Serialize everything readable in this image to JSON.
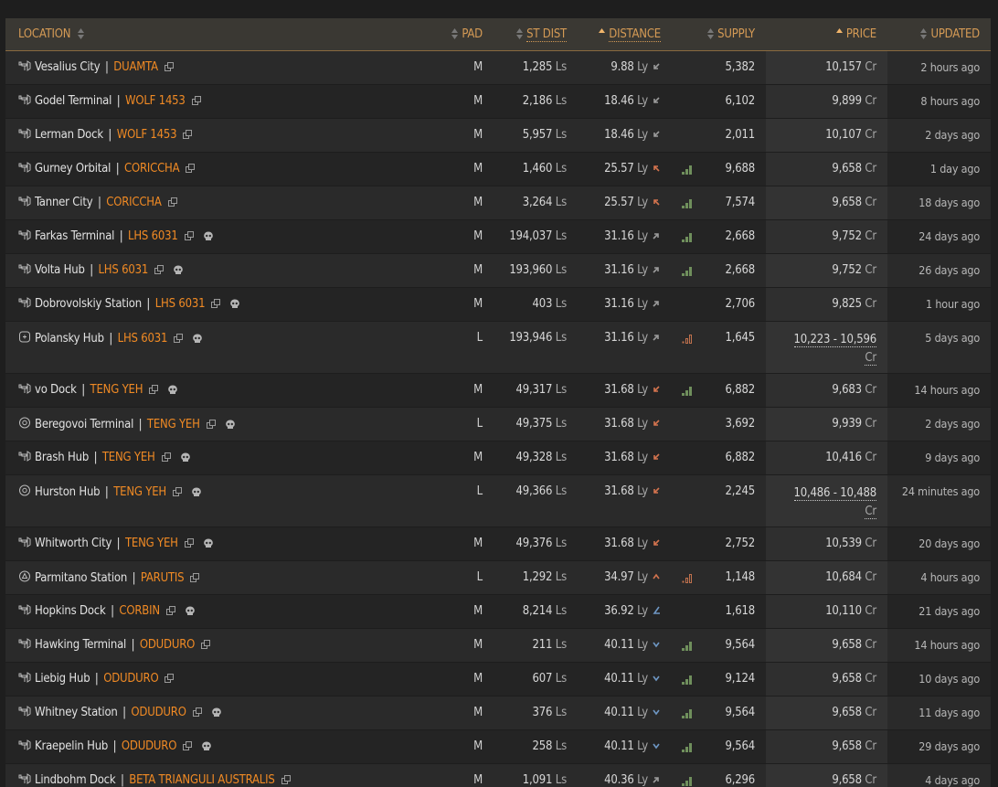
{
  "headers": {
    "location": "LOCATION",
    "pad": "PAD",
    "st_dist": "ST DIST",
    "distance": "DISTANCE",
    "supply": "SUPPLY",
    "price": "PRICE",
    "updated": "UPDATED"
  },
  "colors": {
    "accent": "#f08a24",
    "header_text": "#d49a55",
    "header_bg": "#3a3833",
    "bars_green": "#6f8f5c",
    "bars_low": "#c0714d",
    "dir_orange": "#d3734e",
    "dir_blue": "#6e97c4",
    "dir_gray": "#9a9a9a"
  },
  "rows": [
    {
      "station": "Vesalius City",
      "system": "DUAMTA",
      "icon": "outpost-icon",
      "skull": false,
      "pad": "M",
      "st_dist": "1,285",
      "st_unit": "Ls",
      "distance": "9.88",
      "dist_unit": "Ly",
      "dir": "down-left",
      "dir_color": "gray",
      "supply_bars": "",
      "supply": "5,382",
      "price": "10,157",
      "price_unit": "Cr",
      "price_range": false,
      "updated": "2 hours ago"
    },
    {
      "station": "Godel Terminal",
      "system": "WOLF 1453",
      "icon": "outpost-icon",
      "skull": false,
      "pad": "M",
      "st_dist": "2,186",
      "st_unit": "Ls",
      "distance": "18.46",
      "dist_unit": "Ly",
      "dir": "down-left",
      "dir_color": "gray",
      "supply_bars": "",
      "supply": "6,102",
      "price": "9,899",
      "price_unit": "Cr",
      "price_range": false,
      "updated": "8 hours ago"
    },
    {
      "station": "Lerman Dock",
      "system": "WOLF 1453",
      "icon": "outpost-icon",
      "skull": false,
      "pad": "M",
      "st_dist": "5,957",
      "st_unit": "Ls",
      "distance": "18.46",
      "dist_unit": "Ly",
      "dir": "down-left",
      "dir_color": "gray",
      "supply_bars": "",
      "supply": "2,011",
      "price": "10,107",
      "price_unit": "Cr",
      "price_range": false,
      "updated": "2 days ago"
    },
    {
      "station": "Gurney Orbital",
      "system": "CORICCHA",
      "icon": "outpost-icon",
      "skull": false,
      "pad": "M",
      "st_dist": "1,460",
      "st_unit": "Ls",
      "distance": "25.57",
      "dist_unit": "Ly",
      "dir": "up-left",
      "dir_color": "orange",
      "supply_bars": "high",
      "supply": "9,688",
      "price": "9,658",
      "price_unit": "Cr",
      "price_range": false,
      "updated": "1 day ago"
    },
    {
      "station": "Tanner City",
      "system": "CORICCHA",
      "icon": "outpost-icon",
      "skull": false,
      "pad": "M",
      "st_dist": "3,264",
      "st_unit": "Ls",
      "distance": "25.57",
      "dist_unit": "Ly",
      "dir": "up-left",
      "dir_color": "orange",
      "supply_bars": "high",
      "supply": "7,574",
      "price": "9,658",
      "price_unit": "Cr",
      "price_range": false,
      "updated": "18 days ago"
    },
    {
      "station": "Farkas Terminal",
      "system": "LHS 6031",
      "icon": "outpost-icon",
      "skull": true,
      "pad": "M",
      "st_dist": "194,037",
      "st_unit": "Ls",
      "distance": "31.16",
      "dist_unit": "Ly",
      "dir": "up-right",
      "dir_color": "gray",
      "supply_bars": "high",
      "supply": "2,668",
      "price": "9,752",
      "price_unit": "Cr",
      "price_range": false,
      "updated": "24 days ago"
    },
    {
      "station": "Volta Hub",
      "system": "LHS 6031",
      "icon": "outpost-icon",
      "skull": true,
      "pad": "M",
      "st_dist": "193,960",
      "st_unit": "Ls",
      "distance": "31.16",
      "dist_unit": "Ly",
      "dir": "up-right",
      "dir_color": "gray",
      "supply_bars": "high",
      "supply": "2,668",
      "price": "9,752",
      "price_unit": "Cr",
      "price_range": false,
      "updated": "26 days ago"
    },
    {
      "station": "Dobrovolskiy Station",
      "system": "LHS 6031",
      "icon": "outpost-icon",
      "skull": true,
      "pad": "M",
      "st_dist": "403",
      "st_unit": "Ls",
      "distance": "31.16",
      "dist_unit": "Ly",
      "dir": "up-right",
      "dir_color": "gray",
      "supply_bars": "",
      "supply": "2,706",
      "price": "9,825",
      "price_unit": "Cr",
      "price_range": false,
      "updated": "1 hour ago"
    },
    {
      "station": "Polansky Hub",
      "system": "LHS 6031",
      "icon": "coriolis-icon",
      "skull": true,
      "pad": "L",
      "st_dist": "193,946",
      "st_unit": "Ls",
      "distance": "31.16",
      "dist_unit": "Ly",
      "dir": "up-right",
      "dir_color": "gray",
      "supply_bars": "low",
      "supply": "1,645",
      "price": "10,223 - 10,596",
      "price_unit": "Cr",
      "price_range": true,
      "updated": "5 days ago"
    },
    {
      "station": "vo Dock",
      "system": "TENG YEH",
      "icon": "outpost-icon",
      "skull": true,
      "pad": "M",
      "st_dist": "49,317",
      "st_unit": "Ls",
      "distance": "31.68",
      "dist_unit": "Ly",
      "dir": "down-left",
      "dir_color": "orange",
      "supply_bars": "high",
      "supply": "6,882",
      "price": "9,683",
      "price_unit": "Cr",
      "price_range": false,
      "updated": "14 hours ago"
    },
    {
      "station": "Beregovoi Terminal",
      "system": "TENG YEH",
      "icon": "orbis-icon",
      "skull": true,
      "pad": "L",
      "st_dist": "49,375",
      "st_unit": "Ls",
      "distance": "31.68",
      "dist_unit": "Ly",
      "dir": "down-left",
      "dir_color": "orange",
      "supply_bars": "",
      "supply": "3,692",
      "price": "9,939",
      "price_unit": "Cr",
      "price_range": false,
      "updated": "2 days ago"
    },
    {
      "station": "Brash Hub",
      "system": "TENG YEH",
      "icon": "outpost-icon",
      "skull": true,
      "pad": "M",
      "st_dist": "49,328",
      "st_unit": "Ls",
      "distance": "31.68",
      "dist_unit": "Ly",
      "dir": "down-left",
      "dir_color": "orange",
      "supply_bars": "",
      "supply": "6,882",
      "price": "10,416",
      "price_unit": "Cr",
      "price_range": false,
      "updated": "9 days ago"
    },
    {
      "station": "Hurston Hub",
      "system": "TENG YEH",
      "icon": "orbis-icon",
      "skull": true,
      "pad": "L",
      "st_dist": "49,366",
      "st_unit": "Ls",
      "distance": "31.68",
      "dist_unit": "Ly",
      "dir": "down-left",
      "dir_color": "orange",
      "supply_bars": "",
      "supply": "2,245",
      "price": "10,486 - 10,488",
      "price_unit": "Cr",
      "price_range": true,
      "updated": "24 minutes ago"
    },
    {
      "station": "Whitworth City",
      "system": "TENG YEH",
      "icon": "outpost-icon",
      "skull": true,
      "pad": "M",
      "st_dist": "49,376",
      "st_unit": "Ls",
      "distance": "31.68",
      "dist_unit": "Ly",
      "dir": "down-left",
      "dir_color": "orange",
      "supply_bars": "",
      "supply": "2,752",
      "price": "10,539",
      "price_unit": "Cr",
      "price_range": false,
      "updated": "20 days ago"
    },
    {
      "station": "Parmitano Station",
      "system": "PARUTIS",
      "icon": "ocellus-icon",
      "skull": false,
      "pad": "L",
      "st_dist": "1,292",
      "st_unit": "Ls",
      "distance": "34.97",
      "dist_unit": "Ly",
      "dir": "up",
      "dir_color": "orange",
      "supply_bars": "low",
      "supply": "1,148",
      "price": "10,684",
      "price_unit": "Cr",
      "price_range": false,
      "updated": "4 hours ago"
    },
    {
      "station": "Hopkins Dock",
      "system": "CORBIN",
      "icon": "outpost-icon",
      "skull": true,
      "pad": "M",
      "st_dist": "8,214",
      "st_unit": "Ls",
      "distance": "36.92",
      "dist_unit": "Ly",
      "dir": "down-left-flat",
      "dir_color": "blue",
      "supply_bars": "",
      "supply": "1,618",
      "price": "10,110",
      "price_unit": "Cr",
      "price_range": false,
      "updated": "21 days ago"
    },
    {
      "station": "Hawking Terminal",
      "system": "ODUDURO",
      "icon": "outpost-icon",
      "skull": false,
      "pad": "M",
      "st_dist": "211",
      "st_unit": "Ls",
      "distance": "40.11",
      "dist_unit": "Ly",
      "dir": "down",
      "dir_color": "blue",
      "supply_bars": "high",
      "supply": "9,564",
      "price": "9,658",
      "price_unit": "Cr",
      "price_range": false,
      "updated": "14 hours ago"
    },
    {
      "station": "Liebig Hub",
      "system": "ODUDURO",
      "icon": "outpost-icon",
      "skull": false,
      "pad": "M",
      "st_dist": "607",
      "st_unit": "Ls",
      "distance": "40.11",
      "dist_unit": "Ly",
      "dir": "down",
      "dir_color": "blue",
      "supply_bars": "high",
      "supply": "9,124",
      "price": "9,658",
      "price_unit": "Cr",
      "price_range": false,
      "updated": "10 days ago"
    },
    {
      "station": "Whitney Station",
      "system": "ODUDURO",
      "icon": "outpost-icon",
      "skull": true,
      "pad": "M",
      "st_dist": "376",
      "st_unit": "Ls",
      "distance": "40.11",
      "dist_unit": "Ly",
      "dir": "down",
      "dir_color": "blue",
      "supply_bars": "high",
      "supply": "9,564",
      "price": "9,658",
      "price_unit": "Cr",
      "price_range": false,
      "updated": "11 days ago"
    },
    {
      "station": "Kraepelin Hub",
      "system": "ODUDURO",
      "icon": "outpost-icon",
      "skull": true,
      "pad": "M",
      "st_dist": "258",
      "st_unit": "Ls",
      "distance": "40.11",
      "dist_unit": "Ly",
      "dir": "down",
      "dir_color": "blue",
      "supply_bars": "high",
      "supply": "9,564",
      "price": "9,658",
      "price_unit": "Cr",
      "price_range": false,
      "updated": "29 days ago"
    },
    {
      "station": "Lindbohm Dock",
      "system": "BETA TRIANGULI AUSTRALIS",
      "icon": "outpost-icon",
      "skull": false,
      "pad": "M",
      "st_dist": "1,091",
      "st_unit": "Ls",
      "distance": "40.36",
      "dist_unit": "Ly",
      "dir": "up-right",
      "dir_color": "gray",
      "supply_bars": "high",
      "supply": "6,296",
      "price": "9,658",
      "price_unit": "Cr",
      "price_range": false,
      "updated": "4 days ago"
    }
  ]
}
